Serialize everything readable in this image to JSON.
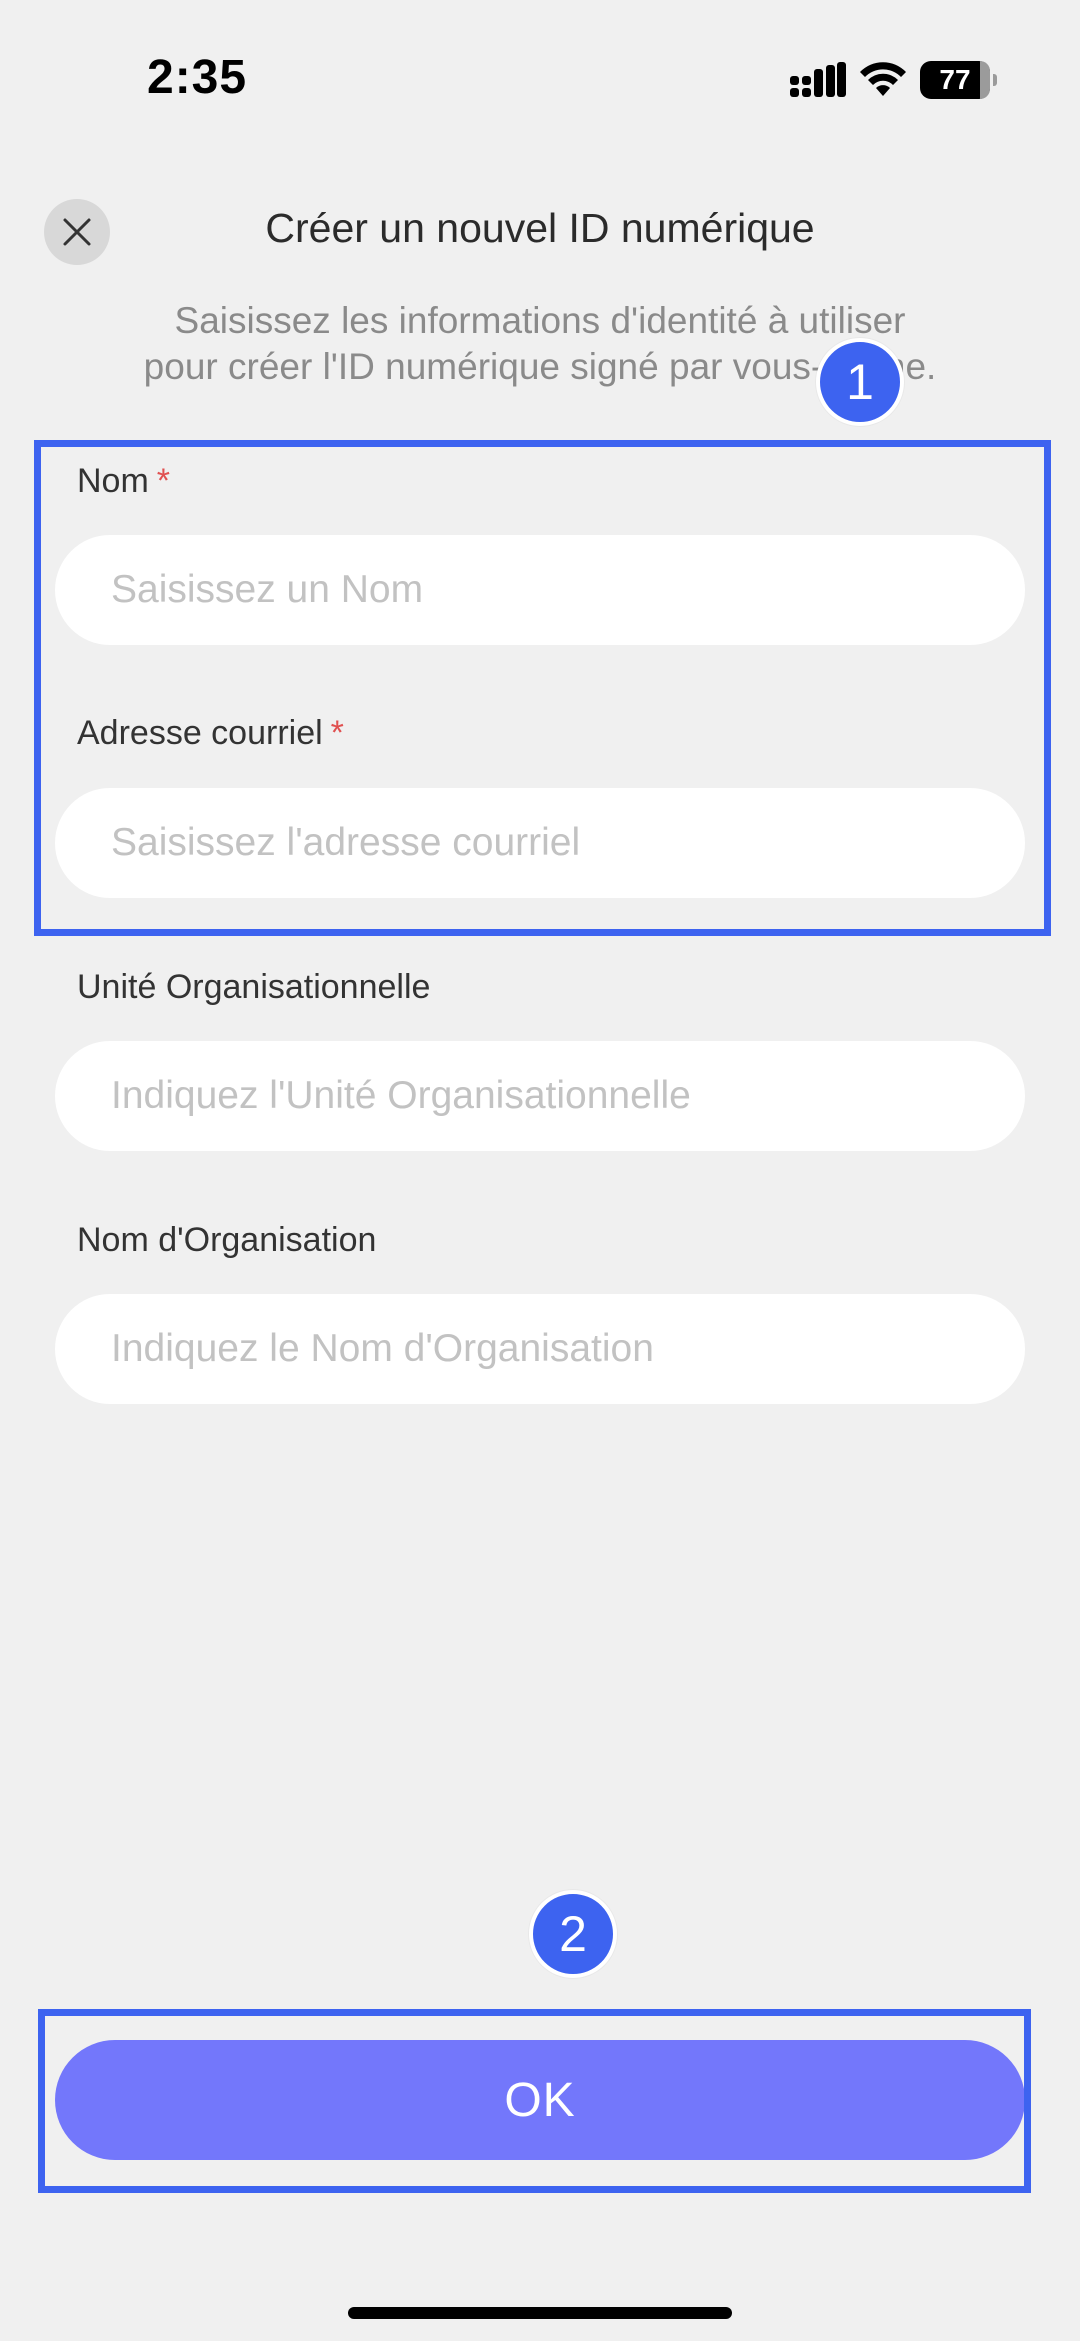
{
  "status_bar": {
    "time": "2:35",
    "battery": "77"
  },
  "header": {
    "close_icon": "close-icon",
    "title": "Créer un nouvel ID numérique",
    "subtitle_line1": "Saisissez les informations d'identité à utiliser",
    "subtitle_line2": "pour créer l'ID numérique signé par vous-même."
  },
  "form": {
    "name": {
      "label": "Nom",
      "required_mark": "*",
      "placeholder": "Saisissez un Nom",
      "value": ""
    },
    "email": {
      "label": "Adresse courriel",
      "required_mark": "*",
      "placeholder": "Saisissez l'adresse courriel",
      "value": ""
    },
    "org_unit": {
      "label": "Unité Organisationnelle",
      "placeholder": "Indiquez l'Unité Organisationnelle",
      "value": ""
    },
    "org_name": {
      "label": "Nom d'Organisation",
      "placeholder": "Indiquez le Nom d'Organisation",
      "value": ""
    }
  },
  "annotations": {
    "step1": "1",
    "step2": "2",
    "accent_color": "#3d63f0"
  },
  "footer": {
    "ok_label": "OK",
    "button_color": "#7377fb"
  }
}
